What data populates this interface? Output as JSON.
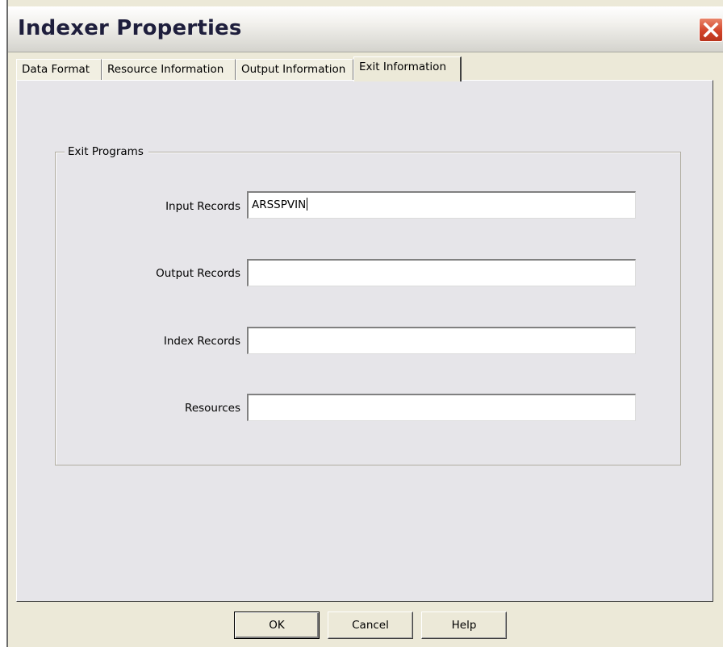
{
  "window": {
    "title": "Indexer Properties"
  },
  "tabs": [
    {
      "label": "Data Format",
      "active": false
    },
    {
      "label": "Resource Information",
      "active": false
    },
    {
      "label": "Output Information",
      "active": false
    },
    {
      "label": "Exit Information",
      "active": true
    }
  ],
  "exit_programs": {
    "legend": "Exit Programs",
    "fields": [
      {
        "label": "Input Records",
        "value": ""
      },
      {
        "label": "Output Records",
        "value": ""
      },
      {
        "label": "Index Records",
        "value": ""
      },
      {
        "label": "Resources",
        "value": ""
      }
    ],
    "input_value": "ARSSPVIN"
  },
  "buttons": {
    "ok": "OK",
    "cancel": "Cancel",
    "help": "Help"
  },
  "colors": {
    "close_button": "#d2442a",
    "dialog_face": "#ece9d8",
    "panel": "#e6e5e9"
  }
}
